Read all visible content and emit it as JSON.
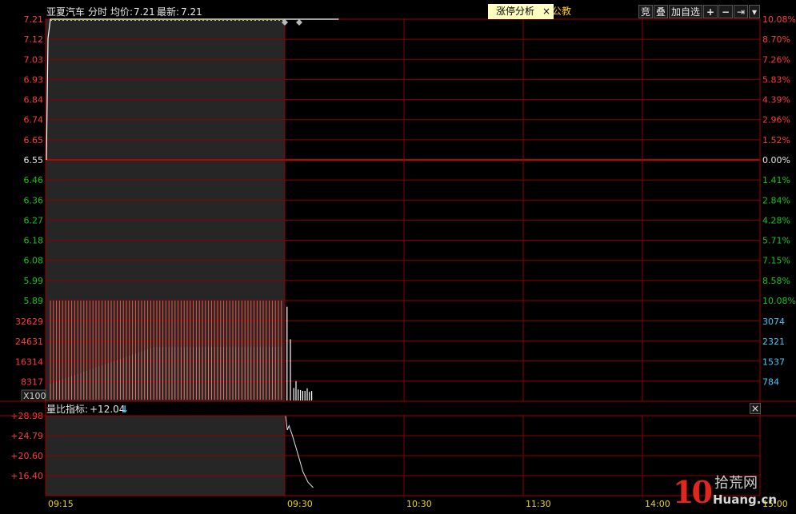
{
  "header": {
    "stock_name": "亚夏汽车",
    "view_label": "分时",
    "avg_label": "均价:",
    "avg_value": "7.21",
    "last_label": "最新:",
    "last_value": "7.21"
  },
  "toolbar": {
    "compete": "竞",
    "overlay": "叠",
    "add_watch": "加自选",
    "plus_icon": "+",
    "minus_icon": "−",
    "end_icon": "⇥",
    "dropdown_icon": "▾"
  },
  "popup": {
    "label": "涨停分析",
    "close": "×",
    "behind_text": "公教"
  },
  "indicator": {
    "label": "量比指标:",
    "value": "+12.04",
    "arrow": "↓"
  },
  "watermark": {
    "digits": "10",
    "cn": "拾荒网",
    "en": "Huang.cn"
  },
  "colors": {
    "grid": "#8b0000",
    "up": "#ff3b3b",
    "down": "#19c419",
    "volume_axis": "#3ec8ff",
    "price_line": "#ffffff"
  },
  "chart_data": {
    "type": "line",
    "price_axis": {
      "left_ticks": [
        "7.21",
        "7.12",
        "7.03",
        "6.93",
        "6.84",
        "6.74",
        "6.65",
        "6.55",
        "6.46",
        "6.36",
        "6.27",
        "6.18",
        "6.08",
        "5.99",
        "5.89"
      ],
      "right_ticks": [
        "10.08%",
        "8.70%",
        "7.26%",
        "5.83%",
        "4.39%",
        "2.96%",
        "1.52%",
        "0.00%",
        "1.41%",
        "2.84%",
        "4.28%",
        "5.71%",
        "7.15%",
        "8.58%",
        "10.08%"
      ],
      "prev_close": 6.55,
      "range": [
        5.89,
        7.21
      ]
    },
    "volume_axis": {
      "left_ticks": [
        "32629",
        "24631",
        "16314",
        "8317"
      ],
      "right_ticks": [
        "3074",
        "2321",
        "1537",
        "784"
      ],
      "unit": "X100"
    },
    "ratio_axis": {
      "left_ticks": [
        "+28.98",
        "+24.79",
        "+20.60",
        "+16.40"
      ]
    },
    "x_ticks": [
      "09:15",
      "09:30",
      "10:30",
      "11:30",
      "14:00",
      "15:00"
    ],
    "series": [
      {
        "x": [
          0,
          2,
          5,
          60,
          120,
          200,
          280
        ],
        "y": [
          6.55,
          7.12,
          7.21,
          7.21,
          7.21,
          7.21,
          7.21
        ]
      }
    ],
    "volume": {
      "x": [
        2,
        5,
        8,
        10,
        12,
        14,
        16,
        18,
        20,
        22,
        24
      ],
      "y": [
        32000,
        21000,
        4500,
        6800,
        4000,
        3800,
        3500,
        3500,
        4400,
        3200,
        3500
      ]
    },
    "ratio": {
      "x": [
        0,
        2,
        4,
        8,
        12,
        16,
        20,
        26,
        32
      ],
      "y": [
        28.98,
        26.3,
        27.1,
        25.2,
        23.0,
        20.8,
        18.5,
        16.5,
        15.5
      ]
    }
  }
}
